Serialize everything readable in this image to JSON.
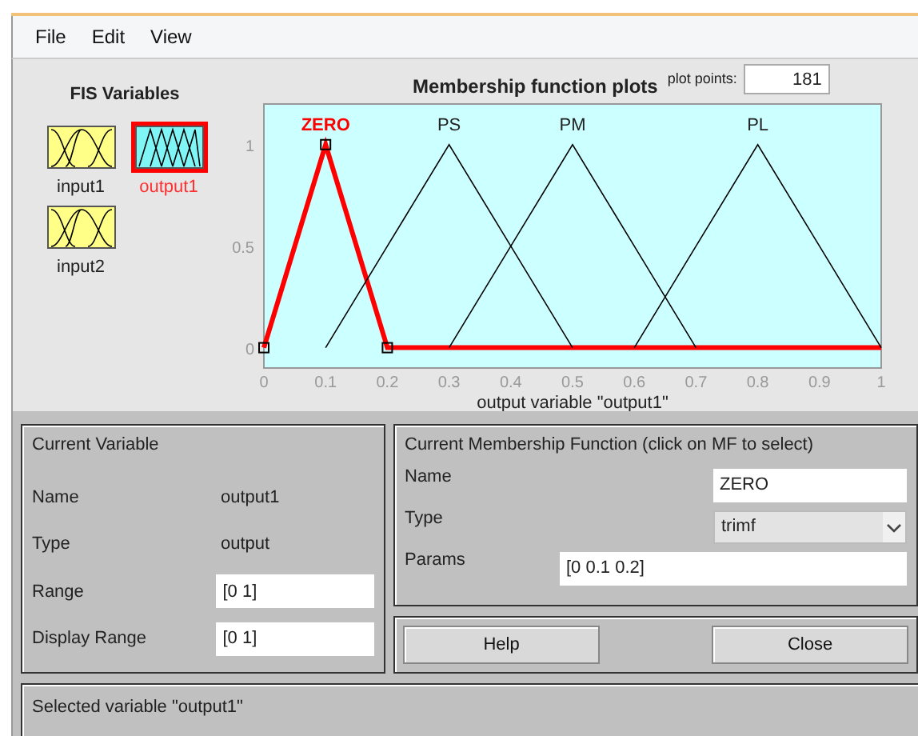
{
  "menu": [
    "File",
    "Edit",
    "View"
  ],
  "fis_variables": {
    "title": "FIS Variables",
    "items": [
      {
        "name": "input1",
        "kind": "input",
        "selected": false
      },
      {
        "name": "output1",
        "kind": "output",
        "selected": true
      },
      {
        "name": "input2",
        "kind": "input",
        "selected": false
      }
    ]
  },
  "plot": {
    "plot_points_label": "plot points:",
    "plot_points": "181",
    "chart_data": {
      "type": "line",
      "title": "Membership function plots",
      "xlabel": "output variable \"output1\"",
      "x": [
        0,
        0.1,
        0.2,
        0.3,
        0.4,
        0.5,
        0.6,
        0.7,
        0.8,
        0.9,
        1
      ],
      "series": [
        {
          "name": "ZERO",
          "color": "#ff0000",
          "values": [
            0,
            1,
            0,
            0,
            0,
            0,
            0,
            0,
            0,
            0,
            0
          ]
        },
        {
          "name": "PS",
          "color": "#000000",
          "values": [
            null,
            0,
            0.5,
            1,
            0.5,
            0,
            null,
            null,
            null,
            null,
            null
          ]
        },
        {
          "name": "PM",
          "color": "#000000",
          "values": [
            null,
            null,
            null,
            0,
            0.5,
            1,
            0.5,
            0,
            null,
            null,
            null
          ]
        },
        {
          "name": "PL",
          "color": "#000000",
          "values": [
            null,
            null,
            null,
            null,
            null,
            null,
            0,
            0.5,
            1,
            0.5,
            0
          ]
        }
      ],
      "xlim": [
        0,
        1
      ],
      "ylim": [
        -0.1,
        1.2
      ],
      "xticks": [
        0,
        0.1,
        0.2,
        0.3,
        0.4,
        0.5,
        0.6,
        0.7,
        0.8,
        0.9,
        1
      ],
      "yticks": [
        0,
        0.5,
        1
      ]
    },
    "curves": [
      {
        "selected": true
      },
      {
        "selected": false
      },
      {
        "selected": false
      },
      {
        "selected": false
      }
    ]
  },
  "current_variable": {
    "title": "Current Variable",
    "rows": [
      {
        "label": "Name",
        "kind": "text",
        "value": "output1"
      },
      {
        "label": "Type",
        "kind": "text",
        "value": "output"
      },
      {
        "label": "Range",
        "kind": "field",
        "value": "[0 1]"
      },
      {
        "label": "Display Range",
        "kind": "field",
        "value": "[0 1]"
      }
    ]
  },
  "current_mf": {
    "title": "Current Membership Function (click on MF to select)",
    "name_label": "Name",
    "name": "ZERO",
    "type_label": "Type",
    "type": "trimf",
    "params_label": "Params",
    "params": "[0 0.1 0.2]"
  },
  "buttons": [
    "Help",
    "Close"
  ],
  "status": "Selected variable \"output1\""
}
